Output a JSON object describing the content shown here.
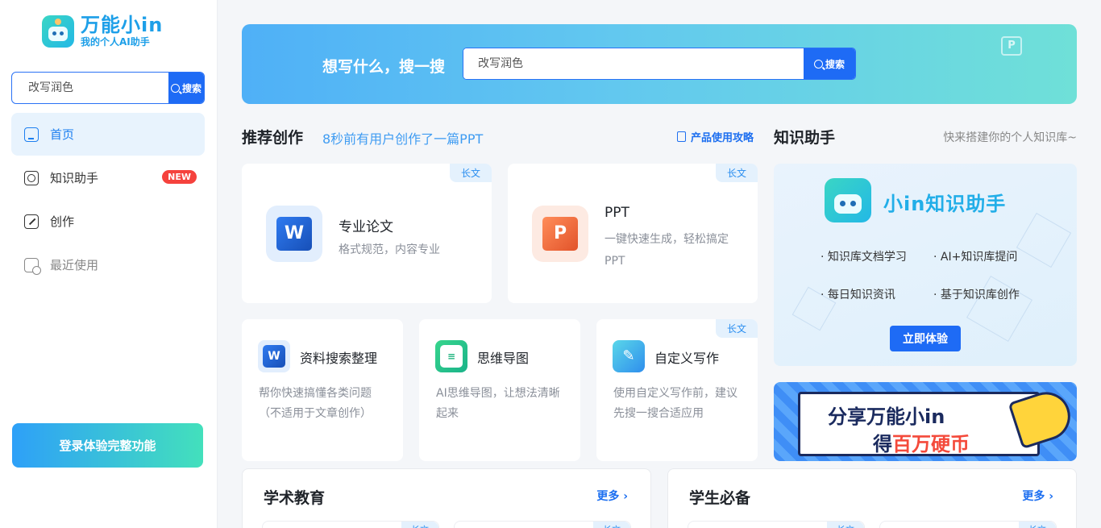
{
  "brand": {
    "title": "万能小in",
    "subtitle": "我的个人AI助手"
  },
  "sidebar": {
    "search": {
      "value": "",
      "placeholder": "改写润色",
      "button": "搜索"
    },
    "nav": [
      {
        "label": "首页",
        "icon": "home-icon",
        "active": true
      },
      {
        "label": "知识助手",
        "icon": "knowledge-icon",
        "badge": "NEW"
      },
      {
        "label": "创作",
        "icon": "edit-icon"
      },
      {
        "label": "最近使用",
        "icon": "recent-icon"
      }
    ],
    "login_button": "登录体验完整功能"
  },
  "banner": {
    "question": "想写什么，搜一搜",
    "search_placeholder": "改写润色",
    "search_button": "搜索",
    "deco_glyph": "P"
  },
  "recommend": {
    "title": "推荐创作",
    "tip": "8秒前有用户创作了一篇PPT",
    "guide": "产品使用攻略",
    "cards": [
      {
        "title": "专业论文",
        "desc": "格式规范，内容专业",
        "tag": "长文",
        "icon": "word-icon",
        "glyph": "W"
      },
      {
        "title": "PPT",
        "desc": "一键快速生成，轻松搞定PPT",
        "tag": "长文",
        "icon": "ppt-icon",
        "glyph": "P"
      }
    ],
    "small_cards": [
      {
        "title": "资料搜索整理",
        "desc": "帮你快速搞懂各类问题（不适用于文章创作）",
        "icon": "word-icon",
        "glyph": "W"
      },
      {
        "title": "思维导图",
        "desc": "AI思维导图，让想法清晰起来",
        "icon": "mindmap-icon",
        "glyph": "≡"
      },
      {
        "title": "自定义写作",
        "desc": "使用自定义写作前，建议先搜一搜合适应用",
        "tag": "长文",
        "icon": "pen-icon",
        "glyph": "✎"
      }
    ]
  },
  "knowledge": {
    "title": "知识助手",
    "hint": "快来搭建你的个人知识库~",
    "brand": "小in知识助手",
    "features": [
      "· 知识库文档学习",
      "· AI+知识库提问",
      "· 每日知识资讯",
      "· 基于知识库创作"
    ],
    "button": "立即体验"
  },
  "share_banner": {
    "line1": "分享万能小in",
    "line2_prefix": "得",
    "line2_highlight": "百万硬币"
  },
  "bottom": [
    {
      "title": "学术教育",
      "more": "更多 ›",
      "tag": "长文"
    },
    {
      "title": "学生必备",
      "more": "更多 ›",
      "tag": "长文"
    }
  ],
  "colors": {
    "primary": "#1e6bf5",
    "accent": "#1d9fe8",
    "badge": "#f5423d"
  }
}
